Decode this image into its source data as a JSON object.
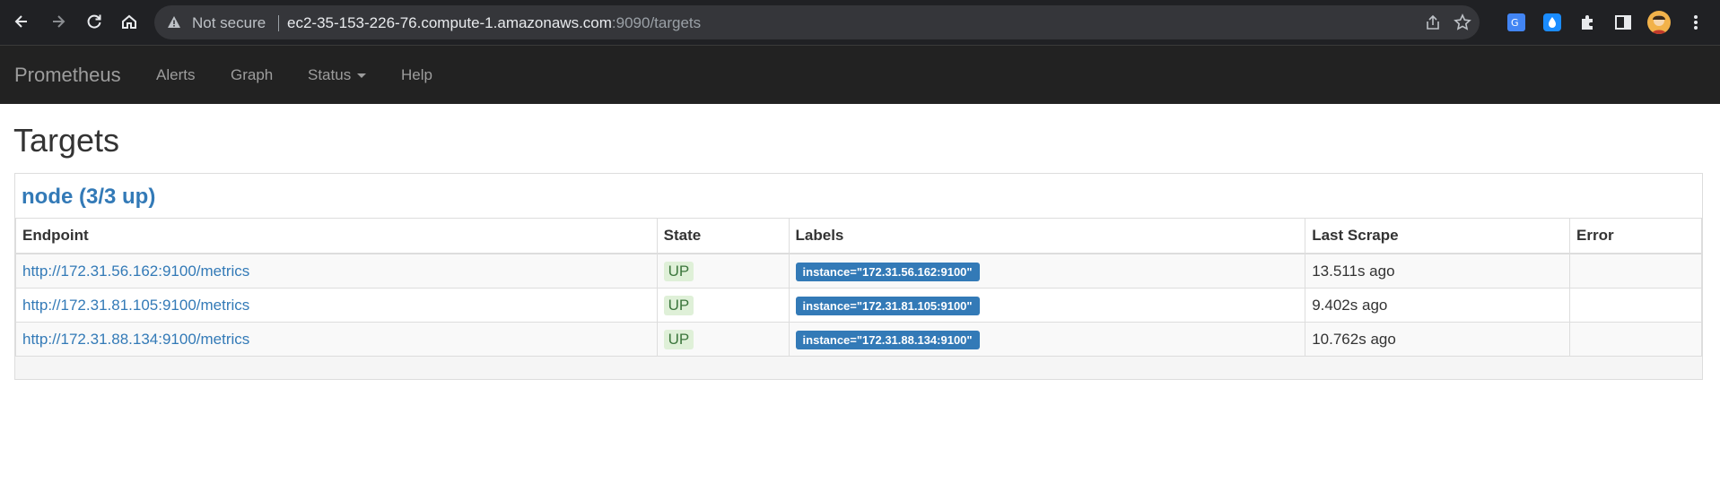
{
  "browser": {
    "security_label": "Not secure",
    "url_host": "ec2-35-153-226-76.compute-1.amazonaws.com",
    "url_rest": ":9090/targets",
    "icons": [
      "back-arrow-icon",
      "forward-arrow-icon",
      "reload-icon",
      "home-icon",
      "warning-icon",
      "share-icon",
      "star-icon",
      "translate-extension-icon",
      "water-drop-extension-icon",
      "puzzle-extensions-icon",
      "side-panel-icon",
      "profile-avatar",
      "kebab-menu-icon"
    ]
  },
  "navbar": {
    "brand": "Prometheus",
    "links": {
      "alerts": "Alerts",
      "graph": "Graph",
      "status": "Status",
      "help": "Help"
    },
    "background": "#222222"
  },
  "page": {
    "title": "Targets"
  },
  "job": {
    "heading": "node (3/3 up)",
    "columns": {
      "endpoint": "Endpoint",
      "state": "State",
      "labels": "Labels",
      "last_scrape": "Last Scrape",
      "error": "Error"
    },
    "rows": [
      {
        "endpoint": "http://172.31.56.162:9100/metrics",
        "state": "UP",
        "label": "instance=\"172.31.56.162:9100\"",
        "last_scrape": "13.511s ago",
        "error": ""
      },
      {
        "endpoint": "http://172.31.81.105:9100/metrics",
        "state": "UP",
        "label": "instance=\"172.31.81.105:9100\"",
        "last_scrape": "9.402s ago",
        "error": ""
      },
      {
        "endpoint": "http://172.31.88.134:9100/metrics",
        "state": "UP",
        "label": "instance=\"172.31.88.134:9100\"",
        "last_scrape": "10.762s ago",
        "error": ""
      }
    ]
  },
  "colors": {
    "link": "#337ab7",
    "up_bg": "#dff0d8",
    "up_text": "#3c763d",
    "label_bg": "#337ab7"
  }
}
